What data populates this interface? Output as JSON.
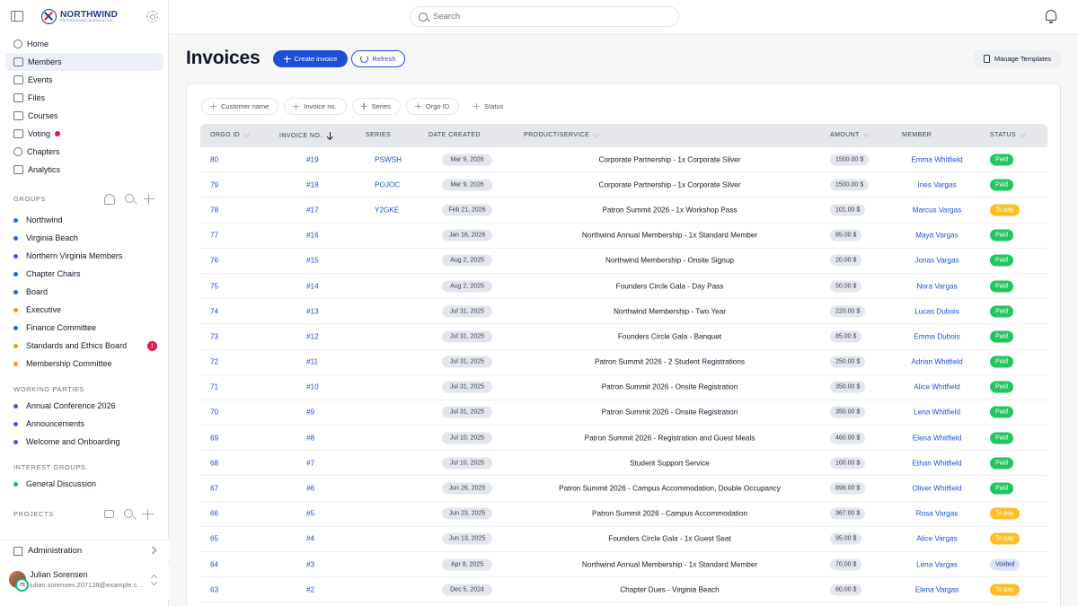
{
  "app": {
    "brand": "NORTHWIND",
    "brand_sub": "PROFESSIONAL ASSOCIATION"
  },
  "search": {
    "placeholder": "Search"
  },
  "nav": [
    {
      "label": "Home",
      "icon": "home-icon",
      "active": false
    },
    {
      "label": "Members",
      "icon": "members-icon",
      "active": true
    },
    {
      "label": "Events",
      "icon": "calendar-icon",
      "active": false
    },
    {
      "label": "Files",
      "icon": "files-icon",
      "active": false
    },
    {
      "label": "Courses",
      "icon": "book-icon",
      "active": false
    },
    {
      "label": "Voting",
      "icon": "voting-icon",
      "active": false,
      "dot": true
    },
    {
      "label": "Chapters",
      "icon": "chapters-icon",
      "active": false
    },
    {
      "label": "Analytics",
      "icon": "analytics-icon",
      "active": false
    }
  ],
  "sections": {
    "groups": "GROUPS",
    "working_parties": "WORKING PARTIES",
    "interest_groups": "INTEREST GROUPS",
    "projects": "PROJECTS"
  },
  "groups": [
    {
      "label": "Northwind",
      "color": "#2563eb"
    },
    {
      "label": "Virginia Beach",
      "color": "#2563eb"
    },
    {
      "label": "Northern Virginia Members",
      "color": "#2563eb"
    },
    {
      "label": "Chapter Chairs",
      "color": "#2563eb"
    },
    {
      "label": "Board",
      "color": "#2563eb"
    },
    {
      "label": "Executive",
      "color": "#f59e0b"
    },
    {
      "label": "Finance Committee",
      "color": "#2563eb"
    },
    {
      "label": "Standards and Ethics Board",
      "color": "#f59e0b",
      "badge": "1"
    },
    {
      "label": "Membership Committee",
      "color": "#f59e0b"
    }
  ],
  "working_parties": [
    {
      "label": "Annual Conference 2026",
      "color": "#7c3aed"
    },
    {
      "label": "Announcements",
      "color": "#7c3aed"
    },
    {
      "label": "Welcome and Onboarding",
      "color": "#7c3aed"
    }
  ],
  "interest_groups": [
    {
      "label": "General Discussion",
      "color": "#10b981"
    }
  ],
  "admin_label": "Administration",
  "user": {
    "name": "Julian Sorensen",
    "email": "julian.sorensen.207128@example.com",
    "avatar_badge": "75"
  },
  "page": {
    "title": "Invoices",
    "create_label": "Create invoice",
    "refresh_label": "Refresh",
    "templates_label": "Manage Templates"
  },
  "filters": [
    "Customer name",
    "Invoice no.",
    "Series",
    "Orgo ID",
    "Status"
  ],
  "columns": {
    "orgo_id": "ORGO ID",
    "invoice_no": "INVOICE NO.",
    "series": "SERIES",
    "date_created": "DATE CREATED",
    "product": "PRODUCT/SERVICE",
    "amount": "AMOUNT",
    "member": "MEMBER",
    "status": "STATUS"
  },
  "rows": [
    {
      "id": "80",
      "inv": "#19",
      "series": "PSWSH",
      "date": "Mar 9, 2026",
      "product": "Corporate Partnership - 1x Corporate Silver",
      "amount": "1500.00 $",
      "member": "Emma Whitfield",
      "status": "Paid"
    },
    {
      "id": "79",
      "inv": "#18",
      "series": "POJOC",
      "date": "Mar 9, 2026",
      "product": "Corporate Partnership - 1x Corporate Silver",
      "amount": "1500.00 $",
      "member": "Ines Vargas",
      "status": "Paid"
    },
    {
      "id": "78",
      "inv": "#17",
      "series": "Y2GKE",
      "date": "Feb 21, 2026",
      "product": "Patron Summit 2026 - 1x Workshop Pass",
      "amount": "101.00 $",
      "member": "Marcus Vargas",
      "status": "To pay"
    },
    {
      "id": "77",
      "inv": "#16",
      "series": "",
      "date": "Jan 16, 2026",
      "product": "Northwind Annual Membership - 1x Standard Member",
      "amount": "85.00 $",
      "member": "Maya Vargas",
      "status": "Paid"
    },
    {
      "id": "76",
      "inv": "#15",
      "series": "",
      "date": "Aug 2, 2025",
      "product": "Northwind Membership - Onsite Signup",
      "amount": "20.00 $",
      "member": "Jonas Vargas",
      "status": "Paid"
    },
    {
      "id": "75",
      "inv": "#14",
      "series": "",
      "date": "Aug 2, 2025",
      "product": "Founders Circle Gala - Day Pass",
      "amount": "50.00 $",
      "member": "Nora Vargas",
      "status": "Paid"
    },
    {
      "id": "74",
      "inv": "#13",
      "series": "",
      "date": "Jul 31, 2025",
      "product": "Northwind Membership - Two Year",
      "amount": "220.00 $",
      "member": "Lucas Dubois",
      "status": "Paid"
    },
    {
      "id": "73",
      "inv": "#12",
      "series": "",
      "date": "Jul 31, 2025",
      "product": "Founders Circle Gala - Banquet",
      "amount": "85.00 $",
      "member": "Emma Dubois",
      "status": "Paid"
    },
    {
      "id": "72",
      "inv": "#11",
      "series": "",
      "date": "Jul 31, 2025",
      "product": "Patron Summit 2026 - 2 Student Registrations",
      "amount": "250.00 $",
      "member": "Adrian Whitfield",
      "status": "Paid"
    },
    {
      "id": "71",
      "inv": "#10",
      "series": "",
      "date": "Jul 31, 2025",
      "product": "Patron Summit 2026 - Onsite Registration",
      "amount": "350.00 $",
      "member": "Alice Whitfield",
      "status": "Paid"
    },
    {
      "id": "70",
      "inv": "#9",
      "series": "",
      "date": "Jul 31, 2025",
      "product": "Patron Summit 2026 - Onsite Registration",
      "amount": "350.00 $",
      "member": "Lena Whitfield",
      "status": "Paid"
    },
    {
      "id": "69",
      "inv": "#8",
      "series": "",
      "date": "Jul 10, 2025",
      "product": "Patron Summit 2026 - Registration and Guest Meals",
      "amount": "460.00 $",
      "member": "Elena Whitfield",
      "status": "Paid"
    },
    {
      "id": "68",
      "inv": "#7",
      "series": "",
      "date": "Jul 10, 2025",
      "product": "Student Support Service",
      "amount": "100.00 $",
      "member": "Ethan Whitfield",
      "status": "Paid"
    },
    {
      "id": "67",
      "inv": "#6",
      "series": "",
      "date": "Jun 26, 2025",
      "product": "Patron Summit 2026 - Campus Accommodation, Double Occupancy",
      "amount": "898.00 $",
      "member": "Oliver Whitfield",
      "status": "Paid"
    },
    {
      "id": "66",
      "inv": "#5",
      "series": "",
      "date": "Jun 23, 2025",
      "product": "Patron Summit 2026 - Campus Accommodation",
      "amount": "367.00 $",
      "member": "Rosa Vargas",
      "status": "To pay"
    },
    {
      "id": "65",
      "inv": "#4",
      "series": "",
      "date": "Jun 13, 2025",
      "product": "Founders Circle Gala - 1x Guest Seat",
      "amount": "95.00 $",
      "member": "Alice Vargas",
      "status": "To pay"
    },
    {
      "id": "64",
      "inv": "#3",
      "series": "",
      "date": "Apr 8, 2025",
      "product": "Northwind Annual Membership - 1x Standard Member",
      "amount": "70.00 $",
      "member": "Lena Vargas",
      "status": "Voided"
    },
    {
      "id": "63",
      "inv": "#2",
      "series": "",
      "date": "Dec 5, 2024",
      "product": "Chapter Dues - Virginia Beach",
      "amount": "60.00 $",
      "member": "Elena Vargas",
      "status": "To pay"
    }
  ]
}
